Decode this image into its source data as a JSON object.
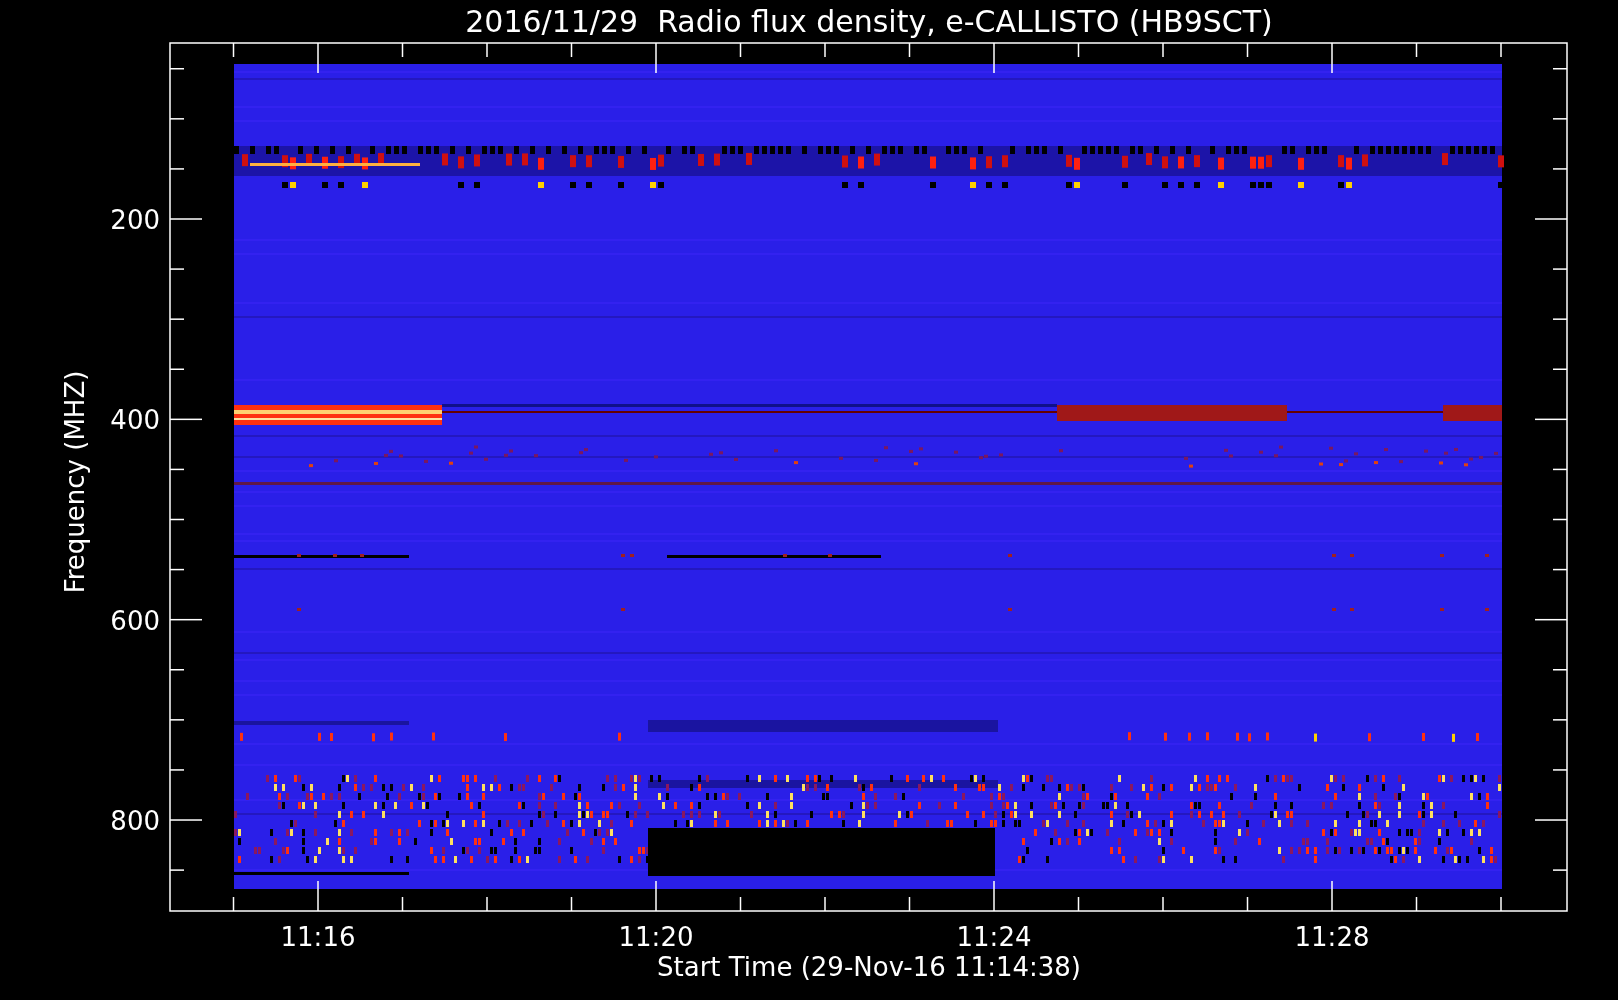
{
  "title": "2016/11/29  Radio flux density, e-CALLISTO (HB9SCT)",
  "ylabel": "Frequency (MHZ)",
  "xlabel": "Start Time (29-Nov-16 11:14:38)",
  "yticks": [
    "200",
    "400",
    "600",
    "800"
  ],
  "xticks": [
    "11:16",
    "11:20",
    "11:24",
    "11:28"
  ]
}
